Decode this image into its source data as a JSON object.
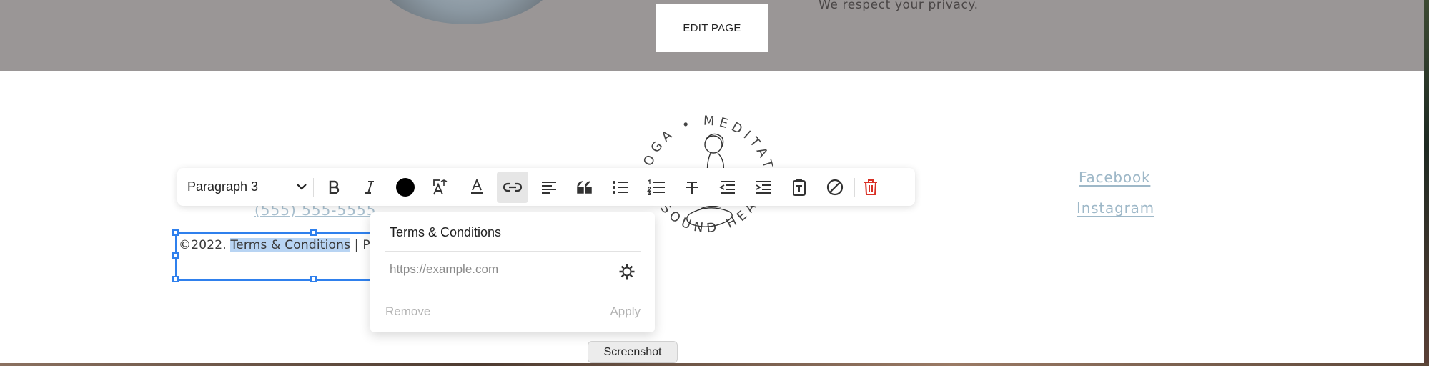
{
  "header": {
    "edit_button_label": "EDIT PAGE",
    "privacy_text": "We respect your privacy."
  },
  "logo": {
    "text_top": "YOGA • MEDITATION",
    "text_bottom": "SOUND HEALING"
  },
  "footer": {
    "phone": "(555) 555-5555",
    "copyright_prefix": "©2022. ",
    "copyright_selected": "Terms & Conditions",
    "copyright_suffix": " | Pr",
    "social_links": [
      "Facebook",
      "Instagram"
    ]
  },
  "toolbar": {
    "paragraph_style": "Paragraph 3",
    "buttons": [
      "bold-icon",
      "italic-icon",
      "text-color-icon",
      "text-size-icon",
      "highlight-icon",
      "link-icon",
      "align-left-icon",
      "blockquote-icon",
      "bullet-list-icon",
      "numbered-list-icon",
      "strikethrough-icon",
      "outdent-icon",
      "indent-icon",
      "paste-plain-text-icon",
      "clear-formatting-icon",
      "delete-icon"
    ],
    "active_button": "link-icon",
    "delete_color": "#d93025"
  },
  "link_popover": {
    "text_value": "Terms & Conditions",
    "url_placeholder": "https://example.com",
    "remove_label": "Remove",
    "apply_label": "Apply"
  },
  "tooltip": {
    "label": "Screenshot"
  },
  "colors": {
    "selection": "#2f80ed",
    "header_band": "#9a9696",
    "link": "#9eb8c8"
  }
}
